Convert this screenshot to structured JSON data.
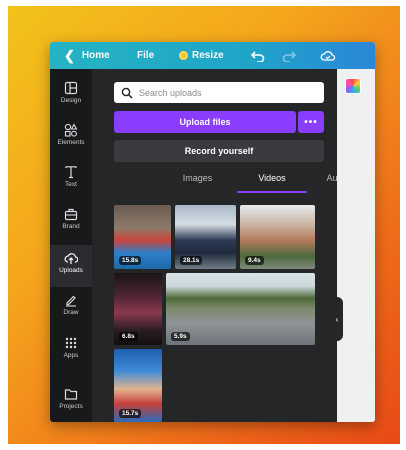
{
  "topbar": {
    "home_label": "Home",
    "file_label": "File",
    "resize_label": "Resize",
    "icons": [
      "chevron-left-icon",
      "crown-icon",
      "undo-icon",
      "redo-icon",
      "cloud-sync-icon"
    ]
  },
  "sidebar": {
    "items": [
      {
        "label": "Design",
        "icon": "layout-icon"
      },
      {
        "label": "Elements",
        "icon": "shapes-icon"
      },
      {
        "label": "Text",
        "icon": "text-icon"
      },
      {
        "label": "Brand",
        "icon": "briefcase-icon"
      },
      {
        "label": "Uploads",
        "icon": "cloud-upload-icon",
        "active": true
      },
      {
        "label": "Draw",
        "icon": "pen-icon"
      },
      {
        "label": "Apps",
        "icon": "grid-icon"
      },
      {
        "label": "Projects",
        "icon": "folder-icon"
      }
    ]
  },
  "panel": {
    "search_placeholder": "Search uploads",
    "upload_button": "Upload files",
    "more_button": "•••",
    "record_button": "Record yourself",
    "tabs": [
      {
        "label": "Images",
        "active": false
      },
      {
        "label": "Videos",
        "active": true
      },
      {
        "label": "Audio",
        "active": false
      }
    ],
    "videos": [
      {
        "duration": "15.8s"
      },
      {
        "duration": "28.1s"
      },
      {
        "duration": "9.4s"
      },
      {
        "duration": "6.8s"
      },
      {
        "duration": "5.9s"
      },
      {
        "duration": "15.7s"
      }
    ]
  },
  "colors": {
    "accent": "#8b3dff",
    "topbar_start": "#25b3c4",
    "topbar_end": "#2b87d8",
    "rail_bg": "#18191b",
    "panel_bg": "#252627"
  }
}
